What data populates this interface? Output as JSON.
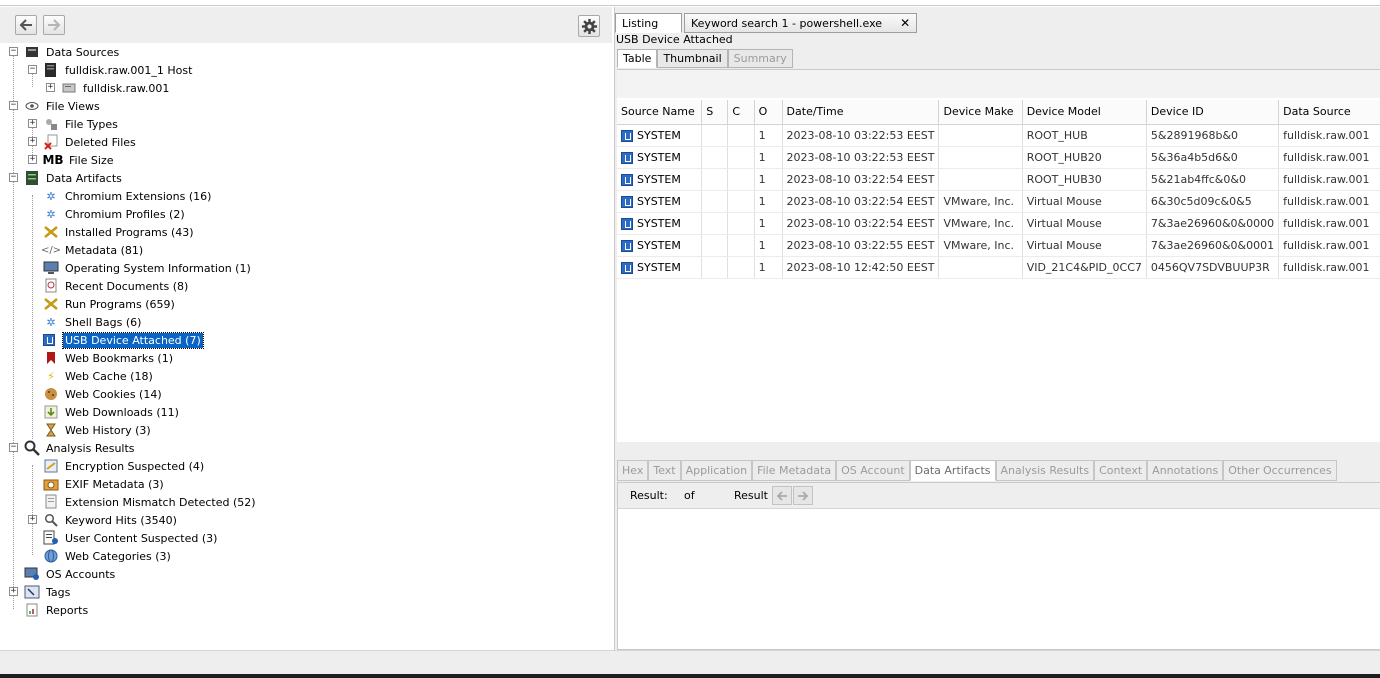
{
  "tree": {
    "data_sources": "Data Sources",
    "host": "fulldisk.raw.001_1 Host",
    "image": "fulldisk.raw.001",
    "file_views": "File Views",
    "file_types": "File Types",
    "deleted_files": "Deleted Files",
    "file_size": "File Size",
    "file_size_icon": "MB",
    "data_artifacts": "Data Artifacts",
    "artifacts": [
      {
        "label": "Chromium Extensions (16)",
        "icon": "puzzle-icon"
      },
      {
        "label": "Chromium Profiles (2)",
        "icon": "puzzle-icon"
      },
      {
        "label": "Installed Programs (43)",
        "icon": "program-icon"
      },
      {
        "label": "Metadata (81)",
        "icon": "code-icon"
      },
      {
        "label": "Operating System Information (1)",
        "icon": "computer-icon"
      },
      {
        "label": "Recent Documents (8)",
        "icon": "document-icon"
      },
      {
        "label": "Run Programs (659)",
        "icon": "program-icon"
      },
      {
        "label": "Shell Bags (6)",
        "icon": "puzzle-icon"
      },
      {
        "label": "USB Device Attached (7)",
        "icon": "usb-icon"
      },
      {
        "label": "Web Bookmarks (1)",
        "icon": "bookmark-icon"
      },
      {
        "label": "Web Cache (18)",
        "icon": "lightning-icon"
      },
      {
        "label": "Web Cookies (14)",
        "icon": "cookie-icon"
      },
      {
        "label": "Web Downloads (11)",
        "icon": "download-icon"
      },
      {
        "label": "Web History (3)",
        "icon": "hourglass-icon"
      }
    ],
    "analysis_results": "Analysis Results",
    "analysis": [
      {
        "label": "Encryption Suspected (4)",
        "icon": "encryption-icon"
      },
      {
        "label": "EXIF Metadata (3)",
        "icon": "camera-icon"
      },
      {
        "label": "Extension Mismatch Detected (52)",
        "icon": "file-mismatch-icon"
      },
      {
        "label": "Keyword Hits (3540)",
        "icon": "magnifier-icon"
      },
      {
        "label": "User Content Suspected (3)",
        "icon": "user-content-icon"
      },
      {
        "label": "Web Categories (3)",
        "icon": "globe-icon"
      }
    ],
    "os_accounts": "OS Accounts",
    "tags": "Tags",
    "reports": "Reports"
  },
  "right": {
    "tabs": [
      {
        "label": "Listing"
      },
      {
        "label": "Keyword search 1 - powershell.exe"
      }
    ],
    "close_glyph": "✕",
    "section_title": "USB Device Attached",
    "subtabs": [
      "Table",
      "Thumbnail",
      "Summary"
    ],
    "columns": [
      "Source Name",
      "S",
      "C",
      "O",
      "Date/Time",
      "Device Make",
      "Device Model",
      "Device ID",
      "Data Source"
    ],
    "rows": [
      [
        "SYSTEM",
        "",
        "",
        "1",
        "2023-08-10 03:22:53 EEST",
        "",
        "ROOT_HUB",
        "5&2891968b&0",
        "fulldisk.raw.001"
      ],
      [
        "SYSTEM",
        "",
        "",
        "1",
        "2023-08-10 03:22:53 EEST",
        "",
        "ROOT_HUB20",
        "5&36a4b5d6&0",
        "fulldisk.raw.001"
      ],
      [
        "SYSTEM",
        "",
        "",
        "1",
        "2023-08-10 03:22:54 EEST",
        "",
        "ROOT_HUB30",
        "5&21ab4ffc&0&0",
        "fulldisk.raw.001"
      ],
      [
        "SYSTEM",
        "",
        "",
        "1",
        "2023-08-10 03:22:54 EEST",
        "VMware, Inc.",
        "Virtual Mouse",
        "6&30c5d09c&0&5",
        "fulldisk.raw.001"
      ],
      [
        "SYSTEM",
        "",
        "",
        "1",
        "2023-08-10 03:22:54 EEST",
        "VMware, Inc.",
        "Virtual Mouse",
        "7&3ae26960&0&0000",
        "fulldisk.raw.001"
      ],
      [
        "SYSTEM",
        "",
        "",
        "1",
        "2023-08-10 03:22:55 EEST",
        "VMware, Inc.",
        "Virtual Mouse",
        "7&3ae26960&0&0001",
        "fulldisk.raw.001"
      ],
      [
        "SYSTEM",
        "",
        "",
        "1",
        "2023-08-10 12:42:50 EEST",
        "",
        "VID_21C4&PID_0CC7",
        "0456QV7SDVBUUP3R",
        "fulldisk.raw.001"
      ]
    ],
    "bottom_tabs": [
      "Hex",
      "Text",
      "Application",
      "File Metadata",
      "OS Account",
      "Data Artifacts",
      "Analysis Results",
      "Context",
      "Annotations",
      "Other Occurrences"
    ],
    "active_bottom_tab": "Data Artifacts",
    "result_label": "Result:",
    "of_label": "of",
    "result_word": "Result"
  },
  "colors": {
    "selection": "#0a64c6",
    "panel_bg": "#eeeeee"
  }
}
